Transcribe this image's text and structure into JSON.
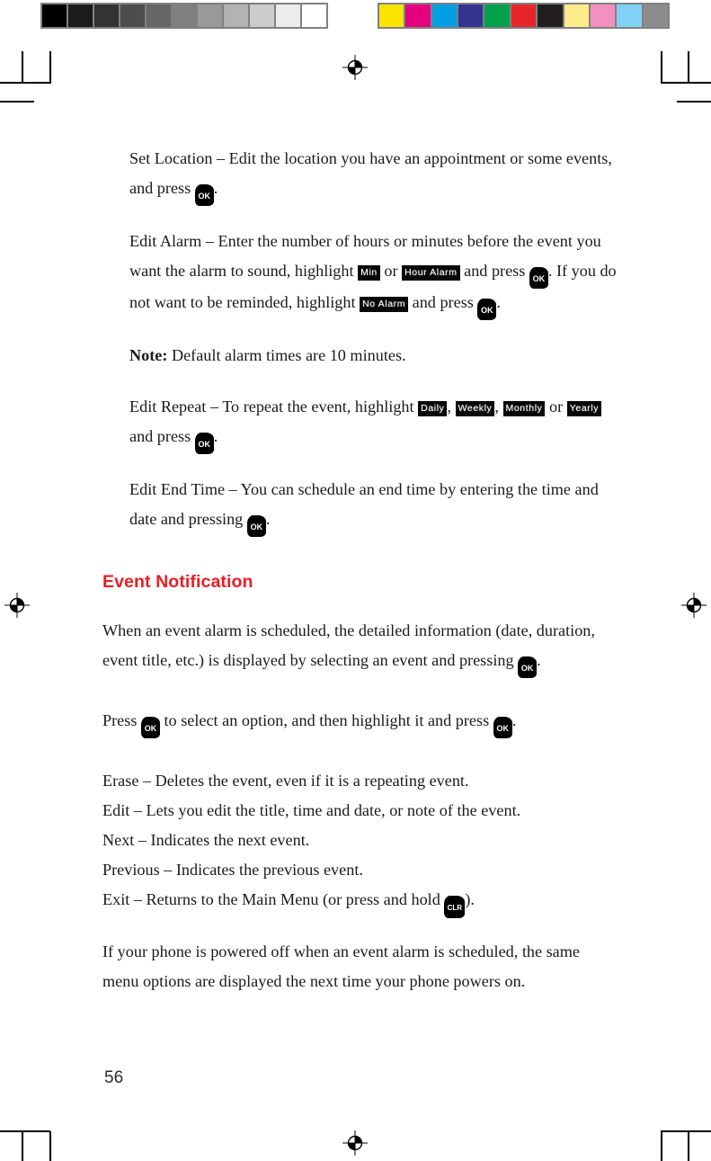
{
  "page": {
    "number": "56"
  },
  "calibration": {
    "grayscale_label": "grayscale-step-wedge",
    "grayscale_patches": [
      "#000000",
      "#1c1c1c",
      "#333333",
      "#4d4d4d",
      "#666666",
      "#7f7f7f",
      "#999999",
      "#b3b3b3",
      "#cccccc",
      "#ececec",
      "#ffffff"
    ],
    "color_label": "color-control-bar",
    "color_patches": [
      "#fbe500",
      "#e6007e",
      "#00a0e0",
      "#33348e",
      "#00a14b",
      "#e8262a",
      "#231f20",
      "#fced8a",
      "#f490bf",
      "#7fd2f5",
      "#8c8c8c"
    ]
  },
  "content": {
    "set_location": {
      "before": "Set Location – Edit the location you have an appointment or some events, and press ",
      "key": "OK",
      "after": "."
    },
    "edit_alarm": {
      "part1": "Edit Alarm – Enter the number of hours or minutes before the event you want the alarm to sound, highlight ",
      "token1": "Min",
      "part2": " or ",
      "token2": "Hour Alarm",
      "part3": " and press ",
      "key1": "OK",
      "part4": ". If you do not want to be reminded, highlight ",
      "token3": "No Alarm",
      "part5": " and press ",
      "key2": "OK",
      "part6": "."
    },
    "note": {
      "label": "Note:",
      "text": " Default alarm times are 10 minutes."
    },
    "edit_repeat": {
      "part1": "Edit Repeat – To repeat the event, highlight ",
      "token1": "Daily",
      "part2": ", ",
      "token2": "Weekly",
      "part3": ", ",
      "token3": "Monthly",
      "part4": " or ",
      "token4": "Yearly",
      "part5": " and press ",
      "key": "OK",
      "part6": "."
    },
    "edit_end_time": {
      "before": "Edit End Time – You can schedule an end time by entering the time and date and pressing ",
      "key": "OK",
      "after": "."
    },
    "section_heading": "Event Notification",
    "notification_intro": {
      "before": "When an event alarm is scheduled, the detailed information (date, duration, event title, etc.) is displayed by selecting an event and pressing ",
      "key": "OK",
      "after": "."
    },
    "press_select": {
      "before": "Press ",
      "key1": "OK",
      "middle": " to select an option, and then highlight it and press ",
      "key2": "OK",
      "after": "."
    },
    "options": {
      "erase": "Erase – Deletes the event, even if it is a repeating event.",
      "edit": "Edit – Lets you edit the title, time and date, or note of the event.",
      "next": "Next – Indicates the next event.",
      "previous": "Previous – Indicates the previous event.",
      "exit_before": "Exit – Returns to the Main Menu (or press and hold ",
      "exit_key": "CLR",
      "exit_after": ")."
    },
    "powered_off": "If your phone is powered off when an event alarm is scheduled, the same menu options are displayed the next time your phone powers on."
  }
}
